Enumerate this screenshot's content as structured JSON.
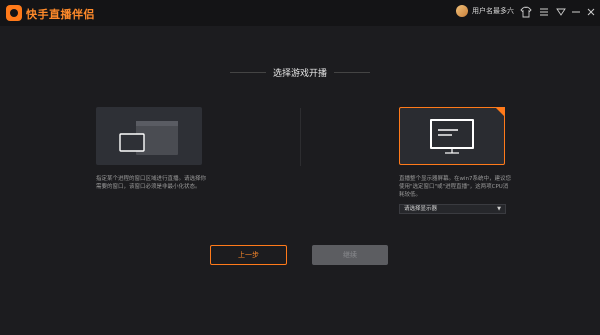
{
  "titlebar": {
    "app_title": "快手直播伴侣",
    "username": "用户名最多六",
    "icons": [
      "shirt-icon",
      "menu-icon",
      "minimize-icon",
      "close-icon",
      "dropdown-icon"
    ]
  },
  "page": {
    "heading": "选择游戏开播"
  },
  "options": {
    "window": {
      "description": "指定某个进程的窗口区域进行直播。请选择你需要的窗口，该窗口必须是非最小化状态。"
    },
    "screen": {
      "description": "直播整个显示器屏幕。在win7系统中，建议您使用\"选定窗口\"或\"进程直播\"，这两项CPU消耗较低。",
      "select_label": "请选择显示器"
    }
  },
  "buttons": {
    "back": "上一步",
    "next": "继续"
  },
  "colors": {
    "accent": "#ff7a1a",
    "background": "#1c1c1f",
    "titlebar": "#141416"
  }
}
